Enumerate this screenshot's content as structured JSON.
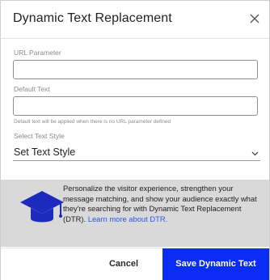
{
  "dialog": {
    "title": "Dynamic Text Replacement",
    "close_icon": "close-icon"
  },
  "form": {
    "url_parameter": {
      "label": "URL Parameter",
      "value": "",
      "placeholder": ""
    },
    "default_text": {
      "label": "Default Text",
      "value": "",
      "placeholder": "",
      "helper": "Default text will be applied when there is no URL parameter defined"
    },
    "text_style": {
      "label": "Select Text Style",
      "selected": "Set Text Style",
      "chevron_icon": "chevron-down-icon"
    }
  },
  "banner": {
    "icon": "graduation-cap-icon",
    "text": "Personalize the visitor experience, strengthen your message matching, and show your audience exactly what they're searching for with Dynamic Text Replacement (DTR).",
    "link": "Learn more about DTR."
  },
  "footer": {
    "cancel_label": "Cancel",
    "save_label": "Save Dynamic Text"
  },
  "colors": {
    "primary": "#0a2cf5",
    "link": "#2a59e8",
    "banner_bg": "#d9d9d9",
    "icon": "#1c2bbd"
  }
}
